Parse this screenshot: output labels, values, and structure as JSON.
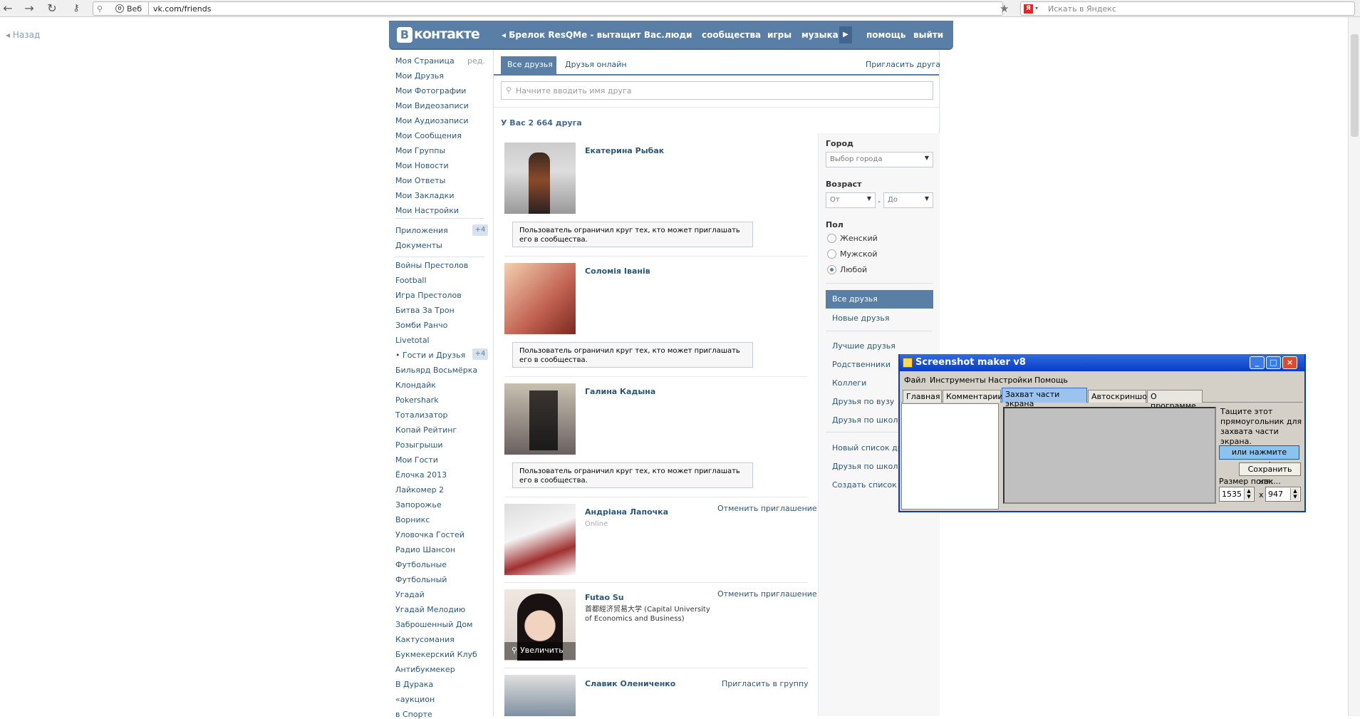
{
  "browser": {
    "web_label": "Веб",
    "url": "vk.com/friends",
    "search_placeholder": "Искать в Яндекс"
  },
  "back_label": "Назад",
  "header": {
    "logo": "контакте",
    "logo_letter": "В",
    "track": "Брелок ResQMe - вытащит Вас...",
    "nav": [
      "люди",
      "сообщества",
      "игры",
      "музыка",
      "помощь",
      "выйти"
    ]
  },
  "left_menu": {
    "edit": "ред.",
    "main": [
      "Моя Страница",
      "Мои Друзья",
      "Мои Фотографии",
      "Мои Видеозаписи",
      "Мои Аудиозаписи",
      "Мои Сообщения",
      "Мои Группы",
      "Мои Новости",
      "Мои Ответы",
      "Мои Закладки",
      "Мои Настройки"
    ],
    "apps": [
      "Приложения",
      "Документы"
    ],
    "apps_badge": "+4",
    "games": [
      "Войны Престолов",
      "Football",
      "Игра Престолов",
      "Битва За Трон",
      "Зомби Ранчо",
      "Livetotal",
      "• Гости и Друзья",
      "Бильярд Восьмёрка",
      "Клондайк",
      "Pokershark",
      "Тотализатор",
      "Копай Рейтинг",
      "Розыгрыши",
      "Мои Гости",
      "Ёлочка 2013",
      "Лайкомер 2",
      "Запорожье",
      "Ворникс",
      "Уловочка Гостей",
      "Радио Шансон",
      "Футбольные",
      "Футбольный",
      "Угадай",
      "Угадай Мелодию",
      "Заброшенный Дом",
      "Кактусомания",
      "Букмекерский Клуб",
      "Антибукмекер",
      "В Дурака",
      "«аукцион",
      "в Спорте"
    ],
    "games_badge": "+4"
  },
  "tabs": {
    "all": "Все друзья",
    "online": "Друзья онлайн",
    "invite": "Пригласить друга"
  },
  "search_placeholder": "Начните вводить имя друга",
  "count_text": "У Вас 2 664 друга",
  "friends": [
    {
      "name": "Екатерина Рыбак"
    },
    {
      "name": "Соломія Іванів"
    },
    {
      "name": "Галина Кадына"
    },
    {
      "name": "Андріана Лапочка",
      "status": "Online",
      "action": "Отменить приглашение"
    },
    {
      "name": "Futao Su",
      "sub1": "首都經济贸易大学 (Capital University",
      "sub2": "of Economics and Business)",
      "action": "Отменить приглашение"
    },
    {
      "name": "Славик Олениченко",
      "action": "Пригласить в группу"
    }
  ],
  "restriction_line1": "Пользователь ограничил круг тех, кто может приглашать",
  "restriction_line2": "его в сообщества.",
  "zoom_label": "Увеличить",
  "filters": {
    "city_label": "Город",
    "city_select": "Выбор города",
    "age_label": "Возраст",
    "age_from": "От",
    "age_to": "До",
    "gender_label": "Пол",
    "genders": [
      "Женский",
      "Мужской",
      "Любой"
    ],
    "gender_selected": "Любой",
    "lists_active": "Все друзья",
    "lists": [
      "Новые друзья",
      "Лучшие друзья",
      "Родственники",
      "Коллеги",
      "Друзья по вузу",
      "Друзья по школе"
    ],
    "more": [
      "Новый список дру",
      "Друзья по школе",
      "Создать список"
    ]
  },
  "screenshot_window": {
    "title": "Screenshot maker v8",
    "menu": [
      "Файл",
      "Инструменты",
      "Настройки",
      "Помощь"
    ],
    "tabs": [
      "Главная",
      "Комментарии",
      "Захват части экрана",
      "Автоскриншот",
      "О программе"
    ],
    "active_tab": "Захват части экрана",
    "instructions": "Тащите этот прямоугольник для захвата части экрана.",
    "click_button": "или нажмите сюда!",
    "save_button": "Сохранить как...",
    "size_label": "Размер поля:",
    "width": "1535",
    "height": "947",
    "times": "x"
  },
  "colors": {
    "brand": "#5a7fa7",
    "link": "#2b587a",
    "xp_title": "#0a3cc8"
  }
}
